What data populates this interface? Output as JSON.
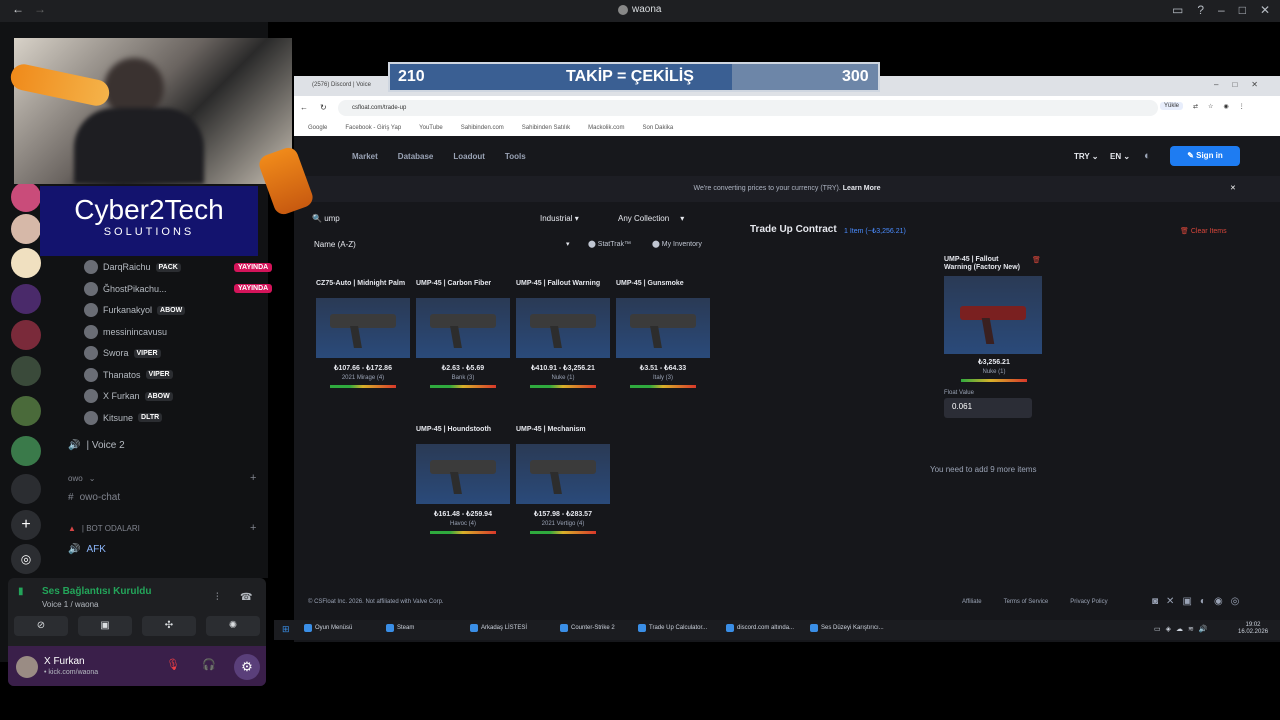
{
  "window": {
    "title": "waona"
  },
  "overlay": {
    "progress_left": "210",
    "progress_center": "TAKİP = ÇEKİLİŞ",
    "progress_right": "300",
    "progress_fraction": 0.7,
    "brand_title": "Cyber2Tech",
    "brand_subtitle": "SOLUTIONS"
  },
  "voice_users": [
    {
      "name": "DarqRaichu",
      "tag": "PACK",
      "live": "YAYINDA"
    },
    {
      "name": "ĞhostPikachu...",
      "tag": "",
      "live": "YAYINDA"
    },
    {
      "name": "Furkanakyol",
      "tag": "ABOW",
      "live": ""
    },
    {
      "name": "messinincavusu",
      "tag": "",
      "live": ""
    },
    {
      "name": "Swora",
      "tag": "VIPER",
      "live": ""
    },
    {
      "name": "Thanatos",
      "tag": "VIPER",
      "live": ""
    },
    {
      "name": "X Furkan",
      "tag": "ABOW",
      "live": ""
    },
    {
      "name": "Kitsune",
      "tag": "DLTR",
      "live": ""
    }
  ],
  "channels": {
    "voice2": "| Voice 2",
    "cat_owo": "owo",
    "owo_chat": "owo-chat",
    "cat_bot": "| BOT ODALARI",
    "afk": "AFK"
  },
  "user_panel": {
    "status": "Ses Bağlantısı Kuruldu",
    "channel": "Voice 1 / waona",
    "username": "X Furkan",
    "substatus": "• kick.com/waona"
  },
  "browser": {
    "tab1": "(2576) Discord | Voice",
    "url": "csfloat.com/trade-up",
    "bookmarks": [
      "Google",
      "Facebook - Giriş Yap",
      "YouTube",
      "Sahibinden.com",
      "Sahibinden Satılık",
      "Mackolik.com",
      "Son Dakika"
    ],
    "btn_yukle": "Yükle"
  },
  "site": {
    "nav": [
      "Market",
      "Database",
      "Loadout",
      "Tools"
    ],
    "currency": "TRY",
    "lang": "EN",
    "sign_in": "Sign in",
    "banner": "We're converting prices to your currency (TRY).",
    "banner_link": "Learn More",
    "search_value": "ump",
    "filter_quality": "Industrial",
    "filter_collection": "Any Collection",
    "sort": "Name (A-Z)",
    "stattrak": "StatTrak™",
    "inventory": "My Inventory",
    "items": [
      {
        "name": "CZ75-Auto | Midnight Palm",
        "price": "₺107.66 - ₺172.86",
        "rarity": "2021 Mirage (4)"
      },
      {
        "name": "UMP-45 | Carbon Fiber",
        "price": "₺2.63 - ₺5.69",
        "rarity": "Bank (3)"
      },
      {
        "name": "UMP-45 | Fallout Warning",
        "price": "₺410.91 - ₺3,256.21",
        "rarity": "Nuke (1)"
      },
      {
        "name": "UMP-45 | Gunsmoke",
        "price": "₺3.51 - ₺64.33",
        "rarity": "Italy (3)"
      },
      {
        "name": "UMP-45 | Houndstooth",
        "price": "₺161.48 - ₺259.94",
        "rarity": "Havoc (4)"
      },
      {
        "name": "UMP-45 | Mechanism",
        "price": "₺157.98 - ₺283.57",
        "rarity": "2021 Vertigo (4)"
      }
    ],
    "trade_title": "Trade Up Contract",
    "trade_count": "1 Item (~₺3,256.21)",
    "clear": "Clear Items",
    "sel_name": "UMP-45 | Fallout Warning (Factory New)",
    "sel_price": "₺3,256.21",
    "sel_rarity": "Nuke (1)",
    "float_label": "Float Value",
    "float_value": "0.061",
    "need_more": "You need to add 9 more items",
    "footer_copy": "© CSFloat Inc. 2026. Not affiliated with Valve Corp.",
    "footer_links": [
      "Affiliate",
      "Terms of Service",
      "Privacy Policy"
    ]
  },
  "taskbar": {
    "items": [
      "Oyun Menüsü",
      "Steam",
      "Arkadaş LİSTESİ",
      "Counter-Strike 2",
      "Trade Up Calculator...",
      "discord.com altında...",
      "Ses Düzeyi Karıştırıcı..."
    ],
    "time": "19:02",
    "date": "16.02.2026"
  }
}
